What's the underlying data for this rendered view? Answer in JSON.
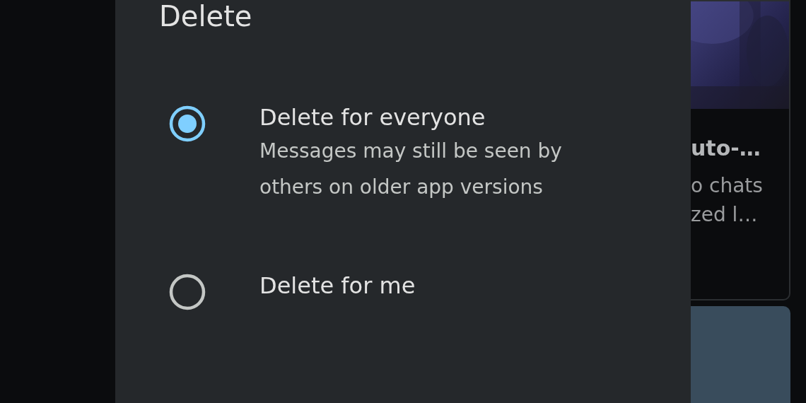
{
  "dialog": {
    "title": "Delete",
    "options": [
      {
        "label": "Delete for everyone",
        "description": "Messages may still be seen by others on older app versions",
        "selected": true
      },
      {
        "label": "Delete for me",
        "selected": false
      }
    ]
  },
  "background_card": {
    "title": "uto-…",
    "lines": [
      "o chats",
      "zed l…"
    ]
  }
}
